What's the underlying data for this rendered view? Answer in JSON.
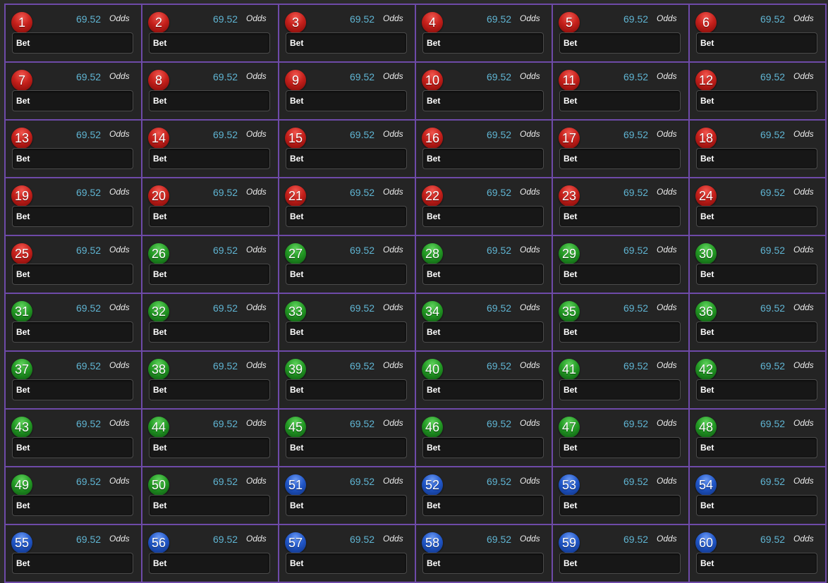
{
  "colors": {
    "red": "#c5201b",
    "green": "#239a24",
    "blue": "#2157c9",
    "odds_value": "#5fb4d2",
    "grid_border": "#6e4aa8"
  },
  "cells": [
    {
      "number": "1",
      "color": "red",
      "odds": "69.52",
      "odds_label": "Odds",
      "bet_placeholder": "Bet"
    },
    {
      "number": "2",
      "color": "red",
      "odds": "69.52",
      "odds_label": "Odds",
      "bet_placeholder": "Bet"
    },
    {
      "number": "3",
      "color": "red",
      "odds": "69.52",
      "odds_label": "Odds",
      "bet_placeholder": "Bet"
    },
    {
      "number": "4",
      "color": "red",
      "odds": "69.52",
      "odds_label": "Odds",
      "bet_placeholder": "Bet"
    },
    {
      "number": "5",
      "color": "red",
      "odds": "69.52",
      "odds_label": "Odds",
      "bet_placeholder": "Bet"
    },
    {
      "number": "6",
      "color": "red",
      "odds": "69.52",
      "odds_label": "Odds",
      "bet_placeholder": "Bet"
    },
    {
      "number": "7",
      "color": "red",
      "odds": "69.52",
      "odds_label": "Odds",
      "bet_placeholder": "Bet"
    },
    {
      "number": "8",
      "color": "red",
      "odds": "69.52",
      "odds_label": "Odds",
      "bet_placeholder": "Bet"
    },
    {
      "number": "9",
      "color": "red",
      "odds": "69.52",
      "odds_label": "Odds",
      "bet_placeholder": "Bet"
    },
    {
      "number": "10",
      "color": "red",
      "odds": "69.52",
      "odds_label": "Odds",
      "bet_placeholder": "Bet"
    },
    {
      "number": "11",
      "color": "red",
      "odds": "69.52",
      "odds_label": "Odds",
      "bet_placeholder": "Bet"
    },
    {
      "number": "12",
      "color": "red",
      "odds": "69.52",
      "odds_label": "Odds",
      "bet_placeholder": "Bet"
    },
    {
      "number": "13",
      "color": "red",
      "odds": "69.52",
      "odds_label": "Odds",
      "bet_placeholder": "Bet"
    },
    {
      "number": "14",
      "color": "red",
      "odds": "69.52",
      "odds_label": "Odds",
      "bet_placeholder": "Bet"
    },
    {
      "number": "15",
      "color": "red",
      "odds": "69.52",
      "odds_label": "Odds",
      "bet_placeholder": "Bet"
    },
    {
      "number": "16",
      "color": "red",
      "odds": "69.52",
      "odds_label": "Odds",
      "bet_placeholder": "Bet"
    },
    {
      "number": "17",
      "color": "red",
      "odds": "69.52",
      "odds_label": "Odds",
      "bet_placeholder": "Bet"
    },
    {
      "number": "18",
      "color": "red",
      "odds": "69.52",
      "odds_label": "Odds",
      "bet_placeholder": "Bet"
    },
    {
      "number": "19",
      "color": "red",
      "odds": "69.52",
      "odds_label": "Odds",
      "bet_placeholder": "Bet"
    },
    {
      "number": "20",
      "color": "red",
      "odds": "69.52",
      "odds_label": "Odds",
      "bet_placeholder": "Bet"
    },
    {
      "number": "21",
      "color": "red",
      "odds": "69.52",
      "odds_label": "Odds",
      "bet_placeholder": "Bet"
    },
    {
      "number": "22",
      "color": "red",
      "odds": "69.52",
      "odds_label": "Odds",
      "bet_placeholder": "Bet"
    },
    {
      "number": "23",
      "color": "red",
      "odds": "69.52",
      "odds_label": "Odds",
      "bet_placeholder": "Bet"
    },
    {
      "number": "24",
      "color": "red",
      "odds": "69.52",
      "odds_label": "Odds",
      "bet_placeholder": "Bet"
    },
    {
      "number": "25",
      "color": "red",
      "odds": "69.52",
      "odds_label": "Odds",
      "bet_placeholder": "Bet"
    },
    {
      "number": "26",
      "color": "green",
      "odds": "69.52",
      "odds_label": "Odds",
      "bet_placeholder": "Bet"
    },
    {
      "number": "27",
      "color": "green",
      "odds": "69.52",
      "odds_label": "Odds",
      "bet_placeholder": "Bet"
    },
    {
      "number": "28",
      "color": "green",
      "odds": "69.52",
      "odds_label": "Odds",
      "bet_placeholder": "Bet"
    },
    {
      "number": "29",
      "color": "green",
      "odds": "69.52",
      "odds_label": "Odds",
      "bet_placeholder": "Bet"
    },
    {
      "number": "30",
      "color": "green",
      "odds": "69.52",
      "odds_label": "Odds",
      "bet_placeholder": "Bet"
    },
    {
      "number": "31",
      "color": "green",
      "odds": "69.52",
      "odds_label": "Odds",
      "bet_placeholder": "Bet"
    },
    {
      "number": "32",
      "color": "green",
      "odds": "69.52",
      "odds_label": "Odds",
      "bet_placeholder": "Bet"
    },
    {
      "number": "33",
      "color": "green",
      "odds": "69.52",
      "odds_label": "Odds",
      "bet_placeholder": "Bet"
    },
    {
      "number": "34",
      "color": "green",
      "odds": "69.52",
      "odds_label": "Odds",
      "bet_placeholder": "Bet"
    },
    {
      "number": "35",
      "color": "green",
      "odds": "69.52",
      "odds_label": "Odds",
      "bet_placeholder": "Bet"
    },
    {
      "number": "36",
      "color": "green",
      "odds": "69.52",
      "odds_label": "Odds",
      "bet_placeholder": "Bet"
    },
    {
      "number": "37",
      "color": "green",
      "odds": "69.52",
      "odds_label": "Odds",
      "bet_placeholder": "Bet"
    },
    {
      "number": "38",
      "color": "green",
      "odds": "69.52",
      "odds_label": "Odds",
      "bet_placeholder": "Bet"
    },
    {
      "number": "39",
      "color": "green",
      "odds": "69.52",
      "odds_label": "Odds",
      "bet_placeholder": "Bet"
    },
    {
      "number": "40",
      "color": "green",
      "odds": "69.52",
      "odds_label": "Odds",
      "bet_placeholder": "Bet"
    },
    {
      "number": "41",
      "color": "green",
      "odds": "69.52",
      "odds_label": "Odds",
      "bet_placeholder": "Bet"
    },
    {
      "number": "42",
      "color": "green",
      "odds": "69.52",
      "odds_label": "Odds",
      "bet_placeholder": "Bet"
    },
    {
      "number": "43",
      "color": "green",
      "odds": "69.52",
      "odds_label": "Odds",
      "bet_placeholder": "Bet"
    },
    {
      "number": "44",
      "color": "green",
      "odds": "69.52",
      "odds_label": "Odds",
      "bet_placeholder": "Bet"
    },
    {
      "number": "45",
      "color": "green",
      "odds": "69.52",
      "odds_label": "Odds",
      "bet_placeholder": "Bet"
    },
    {
      "number": "46",
      "color": "green",
      "odds": "69.52",
      "odds_label": "Odds",
      "bet_placeholder": "Bet"
    },
    {
      "number": "47",
      "color": "green",
      "odds": "69.52",
      "odds_label": "Odds",
      "bet_placeholder": "Bet"
    },
    {
      "number": "48",
      "color": "green",
      "odds": "69.52",
      "odds_label": "Odds",
      "bet_placeholder": "Bet"
    },
    {
      "number": "49",
      "color": "green",
      "odds": "69.52",
      "odds_label": "Odds",
      "bet_placeholder": "Bet"
    },
    {
      "number": "50",
      "color": "green",
      "odds": "69.52",
      "odds_label": "Odds",
      "bet_placeholder": "Bet"
    },
    {
      "number": "51",
      "color": "blue",
      "odds": "69.52",
      "odds_label": "Odds",
      "bet_placeholder": "Bet"
    },
    {
      "number": "52",
      "color": "blue",
      "odds": "69.52",
      "odds_label": "Odds",
      "bet_placeholder": "Bet"
    },
    {
      "number": "53",
      "color": "blue",
      "odds": "69.52",
      "odds_label": "Odds",
      "bet_placeholder": "Bet"
    },
    {
      "number": "54",
      "color": "blue",
      "odds": "69.52",
      "odds_label": "Odds",
      "bet_placeholder": "Bet"
    },
    {
      "number": "55",
      "color": "blue",
      "odds": "69.52",
      "odds_label": "Odds",
      "bet_placeholder": "Bet"
    },
    {
      "number": "56",
      "color": "blue",
      "odds": "69.52",
      "odds_label": "Odds",
      "bet_placeholder": "Bet"
    },
    {
      "number": "57",
      "color": "blue",
      "odds": "69.52",
      "odds_label": "Odds",
      "bet_placeholder": "Bet"
    },
    {
      "number": "58",
      "color": "blue",
      "odds": "69.52",
      "odds_label": "Odds",
      "bet_placeholder": "Bet"
    },
    {
      "number": "59",
      "color": "blue",
      "odds": "69.52",
      "odds_label": "Odds",
      "bet_placeholder": "Bet"
    },
    {
      "number": "60",
      "color": "blue",
      "odds": "69.52",
      "odds_label": "Odds",
      "bet_placeholder": "Bet"
    }
  ]
}
